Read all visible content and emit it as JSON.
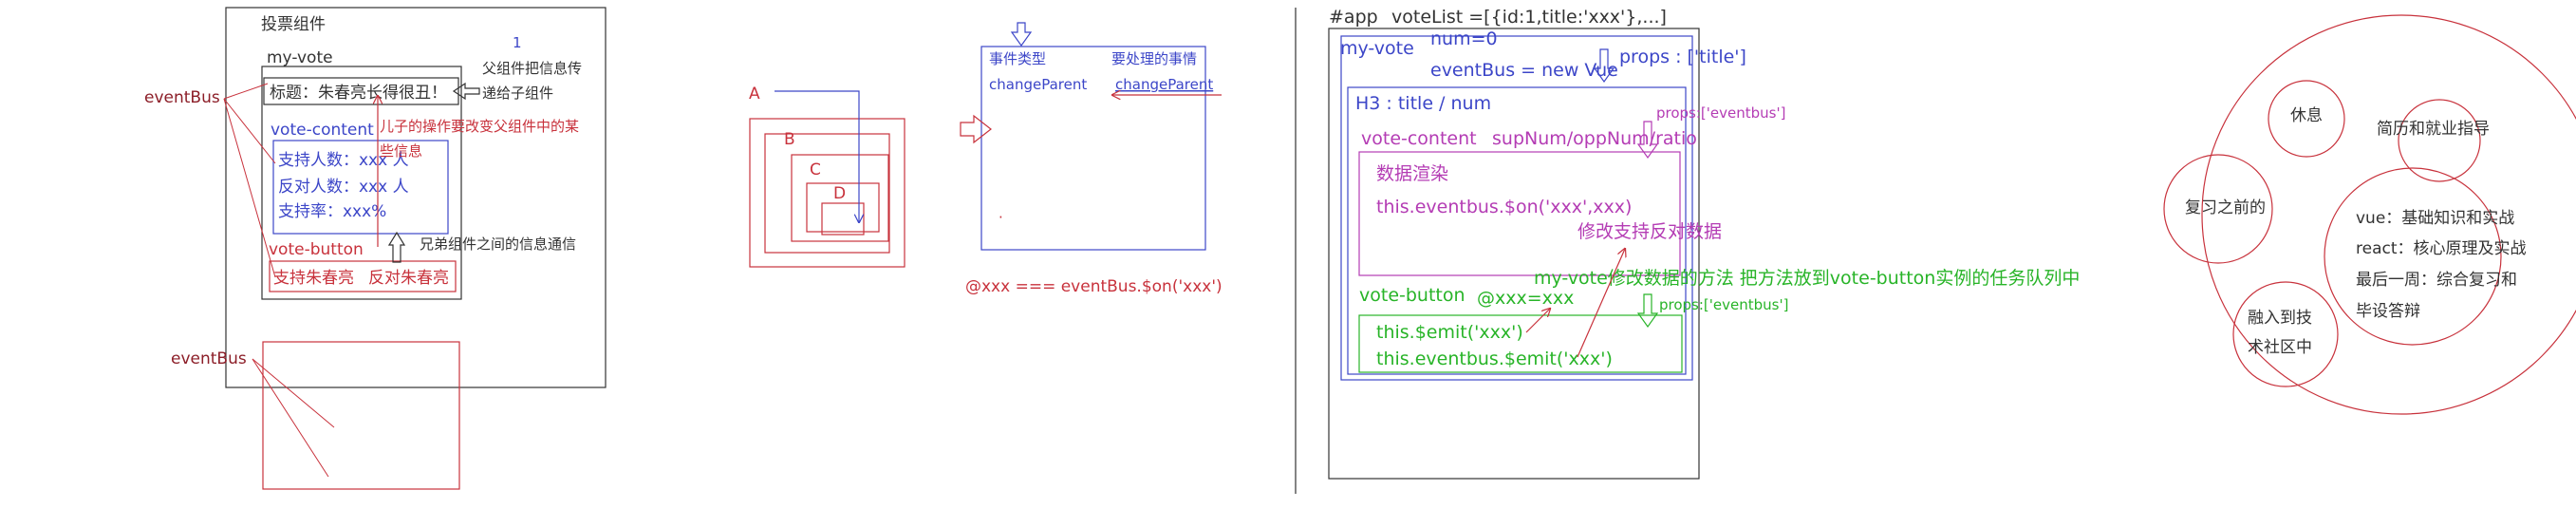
{
  "colors": {
    "black": "#333333",
    "red": "#c8323c",
    "blue": "#3c46c8",
    "purple": "#b43cb4",
    "green": "#28b428",
    "maroon": "#8c1e28"
  },
  "vote_component": {
    "heading": "投票组件",
    "my_vote": "my-vote",
    "title_box": "标题：朱春亮长得很丑！",
    "vote_content": "vote-content",
    "support": "支持人数：xxx 人",
    "oppose": "反对人数：xxx 人",
    "rate": "支持率：xxx%",
    "vote_button": "vote-button",
    "btn_support": "支持朱春亮",
    "btn_oppose": "反对朱春亮",
    "note_number": "1",
    "note_parent_line1": "父组件把信息传",
    "note_parent_line2": "递给子组件",
    "note_child_line1": "儿子的操作要改变父组件中的某",
    "note_child_line2": "些信息",
    "note_sibling": "兄弟组件之间的信息通信",
    "event_bus_top": "eventBus",
    "event_bus_bottom": "eventBus"
  },
  "nested_boxes": {
    "label_a": "A",
    "label_b": "B",
    "label_c": "C",
    "label_d": "D"
  },
  "event_panel": {
    "event_type": "事件类型",
    "to_handle": "要处理的事情",
    "change_parent_left": "changeParent",
    "change_parent_right": "changeParent",
    "dot": "·",
    "formula": "@xxx === eventBus.$on('xxx')"
  },
  "app_diagram": {
    "app_label": "#app",
    "vote_list": "voteList =[{id:1,title:'xxx'},...]",
    "my_vote": "my-vote",
    "num": "num=0",
    "event_bus_new": "eventBus = new Vue",
    "props_title": "props : ['title']",
    "h3": "H3 : title / num",
    "props_eventbus_1": "props:['eventbus']",
    "vote_content": "vote-content",
    "sup_opp": "supNum/oppNum/ratio",
    "render": "数据渲染",
    "on_call": "this.eventbus.$on('xxx',xxx)",
    "modify": "修改支持反对数据",
    "method_note": "my-vote修改数据的方法  把方法放到vote-button实例的任务队列中",
    "vote_button": "vote-button",
    "bind": "@xxx=xxx",
    "props_eventbus_2": "props:['eventbus']",
    "emit_1": "this.$emit('xxx')",
    "emit_2": "this.eventbus.$emit('xxx')"
  },
  "mind_map": {
    "rest": "休息",
    "resume": "简历和就业指导",
    "review": "复习之前的",
    "vue": "vue：基础知识和实战",
    "react": "react：核心原理及实战",
    "last_week_line1": "最后一周：综合复习和",
    "last_week_line2": "毕设答辩",
    "community_line1": "融入到技",
    "community_line2": "术社区中"
  }
}
